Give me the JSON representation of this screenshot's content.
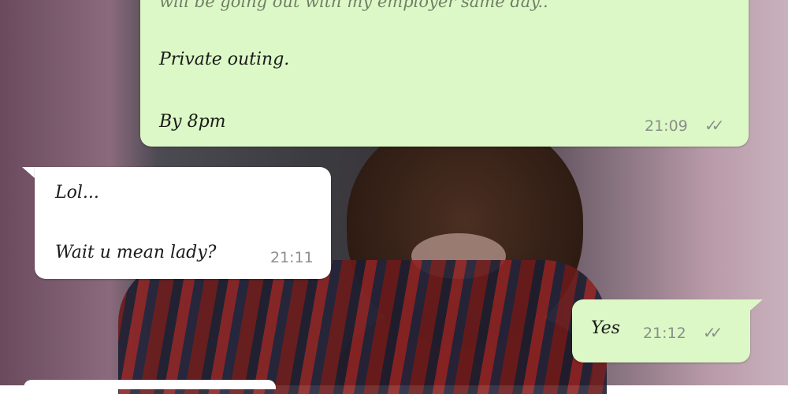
{
  "messages": [
    {
      "direction": "outgoing",
      "lines": [
        "will be going out with my employer same day..",
        "Private outing.",
        "By 8pm"
      ],
      "time": "21:09",
      "ticks": "✓✓"
    },
    {
      "direction": "incoming",
      "lines": [
        "Lol...",
        "Wait u mean lady?"
      ],
      "time": "21:11"
    },
    {
      "direction": "outgoing",
      "lines": [
        "Yes"
      ],
      "time": "21:12",
      "ticks": "✓✓"
    }
  ],
  "colors": {
    "outgoing_bubble": "#dcf8c6",
    "incoming_bubble": "#ffffff",
    "meta_text": "#8a8f8a"
  }
}
